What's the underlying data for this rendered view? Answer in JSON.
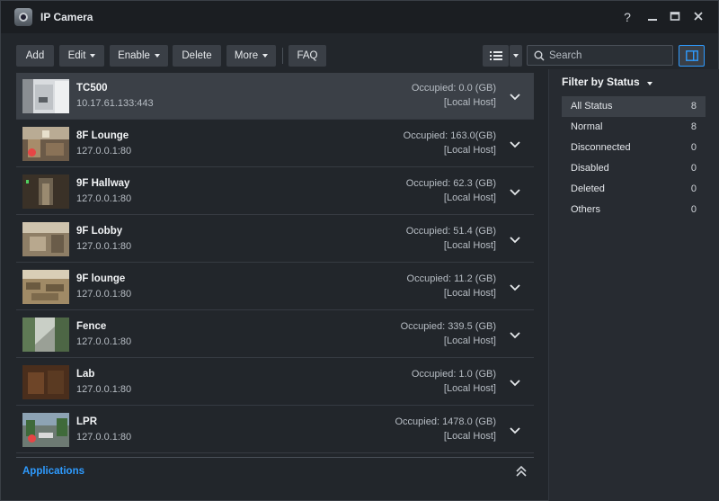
{
  "window": {
    "title": "IP Camera"
  },
  "toolbar": {
    "add": "Add",
    "edit": "Edit",
    "enable": "Enable",
    "delete": "Delete",
    "more": "More",
    "faq": "FAQ",
    "search_placeholder": "Search"
  },
  "cameras": [
    {
      "name": "TC500",
      "address": "10.17.61.133:443",
      "occupied": "Occupied: 0.0 (GB)",
      "host": "[Local Host]"
    },
    {
      "name": "8F Lounge",
      "address": "127.0.0.1:80",
      "occupied": "Occupied: 163.0(GB)",
      "host": "[Local Host]"
    },
    {
      "name": "9F Hallway",
      "address": "127.0.0.1:80",
      "occupied": "Occupied: 62.3 (GB)",
      "host": "[Local Host]"
    },
    {
      "name": "9F Lobby",
      "address": "127.0.0.1:80",
      "occupied": "Occupied: 51.4 (GB)",
      "host": "[Local Host]"
    },
    {
      "name": "9F lounge",
      "address": "127.0.0.1:80",
      "occupied": "Occupied: 11.2 (GB)",
      "host": "[Local Host]"
    },
    {
      "name": "Fence",
      "address": "127.0.0.1:80",
      "occupied": "Occupied: 339.5 (GB)",
      "host": "[Local Host]"
    },
    {
      "name": "Lab",
      "address": "127.0.0.1:80",
      "occupied": "Occupied: 1.0 (GB)",
      "host": "[Local Host]"
    },
    {
      "name": "LPR",
      "address": "127.0.0.1:80",
      "occupied": "Occupied: 1478.0 (GB)",
      "host": "[Local Host]"
    }
  ],
  "applications": {
    "label": "Applications"
  },
  "filter": {
    "title": "Filter by Status",
    "items": [
      {
        "label": "All Status",
        "count": "8"
      },
      {
        "label": "Normal",
        "count": "8"
      },
      {
        "label": "Disconnected",
        "count": "0"
      },
      {
        "label": "Disabled",
        "count": "0"
      },
      {
        "label": "Deleted",
        "count": "0"
      },
      {
        "label": "Others",
        "count": "0"
      }
    ]
  },
  "colors": {
    "accent": "#2e9bff",
    "recording": "#e64545",
    "selected_row": "#3b4047"
  }
}
